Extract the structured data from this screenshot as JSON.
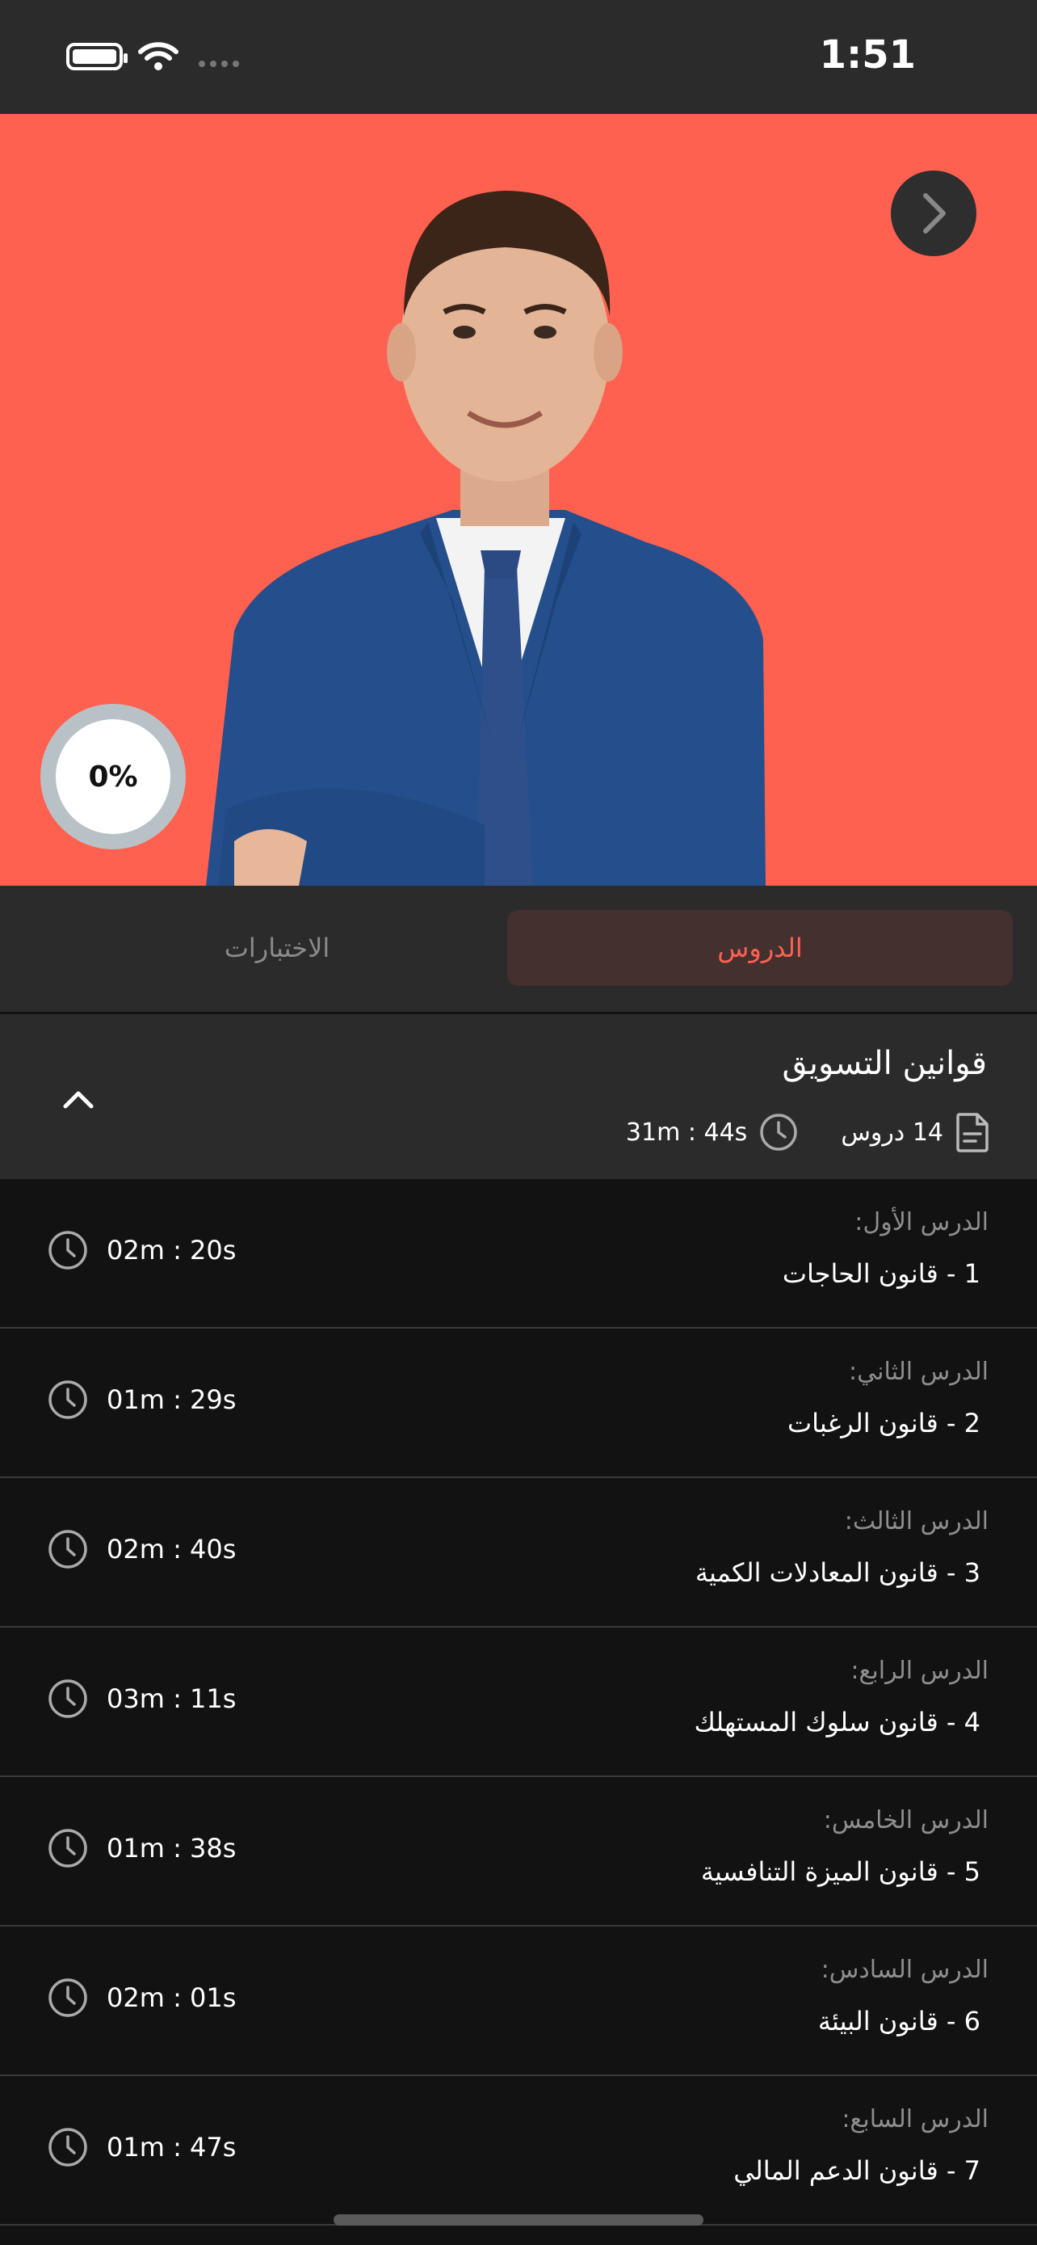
{
  "status_bar": {
    "time": "1:51"
  },
  "hero": {
    "progress_text": "0%"
  },
  "tabs": {
    "lessons": "الدروس",
    "tests": "الاختبارات"
  },
  "section": {
    "title": "قوانين التسويق",
    "lesson_count": "14 دروس",
    "total_duration": "31m : 44s"
  },
  "lessons": [
    {
      "label": "الدرس الأول:",
      "title": "1 - قانون الحاجات",
      "duration": "02m : 20s"
    },
    {
      "label": "الدرس الثاني:",
      "title": "2 - قانون الرغبات",
      "duration": "01m : 29s"
    },
    {
      "label": "الدرس الثالث:",
      "title": "3 - قانون المعادلات الكمية",
      "duration": "02m : 40s"
    },
    {
      "label": "الدرس الرابع:",
      "title": "4 - قانون سلوك المستهلك",
      "duration": "03m : 11s"
    },
    {
      "label": "الدرس الخامس:",
      "title": "5 - قانون الميزة التنافسية",
      "duration": "01m : 38s"
    },
    {
      "label": "الدرس السادس:",
      "title": "6 - قانون البيئة",
      "duration": "02m : 01s"
    },
    {
      "label": "الدرس السابع:",
      "title": "7 - قانون الدعم المالي",
      "duration": "01m : 47s"
    }
  ],
  "colors": {
    "accent": "#ff6150",
    "background": "#121212",
    "panel": "#2b2b2b"
  }
}
